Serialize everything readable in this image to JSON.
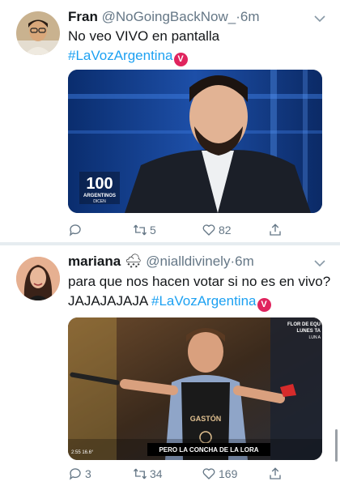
{
  "tweets": [
    {
      "name": "Fran",
      "handle": "@NoGoingBackNow_",
      "separator": "·",
      "time": "6m",
      "text": "No veo VIVO en pantalla",
      "hashtag": "#LaVozArgentina",
      "media": {
        "logo_number": "100",
        "logo_line1": "ARGENTINOS",
        "logo_line2": "DICEN"
      },
      "actions": {
        "reply_count": "",
        "retweet_count": "5",
        "like_count": "82"
      }
    },
    {
      "name": "mariana",
      "name_emoji": "🌨",
      "handle": "@nialldivinely",
      "separator": "·",
      "time": "6m",
      "text": "para que nos hacen votar si no es en vivo? JAJAJAJAJA",
      "hashtag": "#LaVozArgentina",
      "media": {
        "corner_line1": "FLOR DE EQU",
        "corner_line2": "LUNES TA",
        "corner_line3": "LUN A",
        "apron_name": "GASTÓN",
        "timestamp": "2:55 16.6°",
        "subtitle": "PERO LA CONCHA DE LA LORA"
      },
      "actions": {
        "reply_count": "3",
        "retweet_count": "34",
        "like_count": "169"
      }
    }
  ],
  "badge_glyph": "V",
  "colors": {
    "accent": "#1da1f2",
    "muted": "#657786",
    "badge": "#e0245e"
  }
}
